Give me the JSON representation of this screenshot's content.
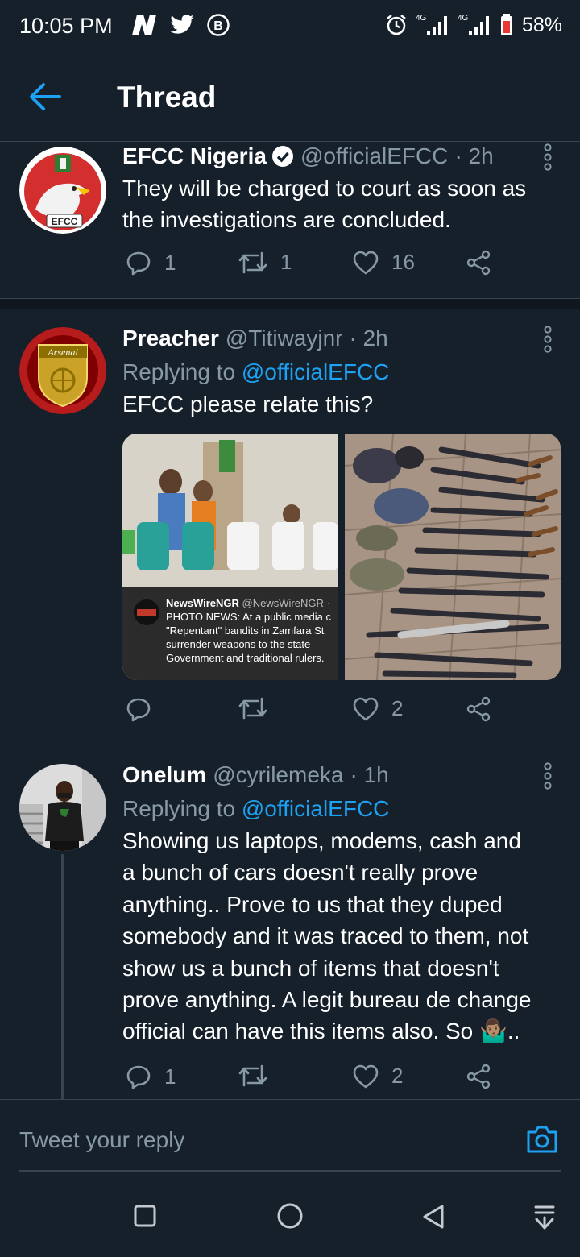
{
  "status_bar": {
    "time": "10:05 PM",
    "battery": "58%",
    "left_icons": [
      "n-icon",
      "twitter-bird-icon",
      "b-circle-icon"
    ],
    "right_icons": [
      "alarm-icon",
      "signal-4g-icon",
      "signal-4g-icon",
      "battery-icon"
    ]
  },
  "header": {
    "title": "Thread"
  },
  "tweets": [
    {
      "name": "EFCC Nigeria",
      "verified": true,
      "handle": "@officialEFCC",
      "time": "· 2h",
      "text": "They will be charged to court as soon as the investigations are concluded.",
      "reply_count": "1",
      "retweet_count": "1",
      "like_count": "16",
      "avatar_text": "EFCC"
    },
    {
      "name": "Preacher",
      "handle": "@Titiwayjnr",
      "time": "· 2h",
      "replying_label": "Replying to",
      "replying_to": "@officialEFCC",
      "text": "EFCC please relate this?",
      "reply_count": "",
      "retweet_count": "",
      "like_count": "2",
      "avatar_text": "Arsenal",
      "media": {
        "embed_name": "NewsWireNGR",
        "embed_handle": "@NewsWireNGR · ",
        "embed_lines": [
          "PHOTO NEWS: At a public media c",
          "\"Repentant\" bandits in Zamfara St",
          "surrender weapons to the state",
          "Government and traditional rulers."
        ]
      }
    },
    {
      "name": "Onelum",
      "handle": "@cyrilemeka",
      "time": "· 1h",
      "replying_label": "Replying to",
      "replying_to": "@officialEFCC",
      "text_lines": [
        "Showing us laptops, modems, cash and",
        "a bunch of cars doesn't really prove",
        "anything.. Prove to us that they duped",
        "somebody and it was traced to them, not",
        "show us a bunch of items that doesn't",
        "prove anything. A legit bureau de change",
        "official can have this items also. So 🤷🏽‍♂️.."
      ],
      "reply_count": "1",
      "retweet_count": "",
      "like_count": "2"
    }
  ],
  "composer": {
    "placeholder": "Tweet your reply"
  },
  "colors": {
    "background": "#15202b",
    "accent": "#1da1f2",
    "muted": "#8899a6",
    "divider": "#38444d"
  }
}
